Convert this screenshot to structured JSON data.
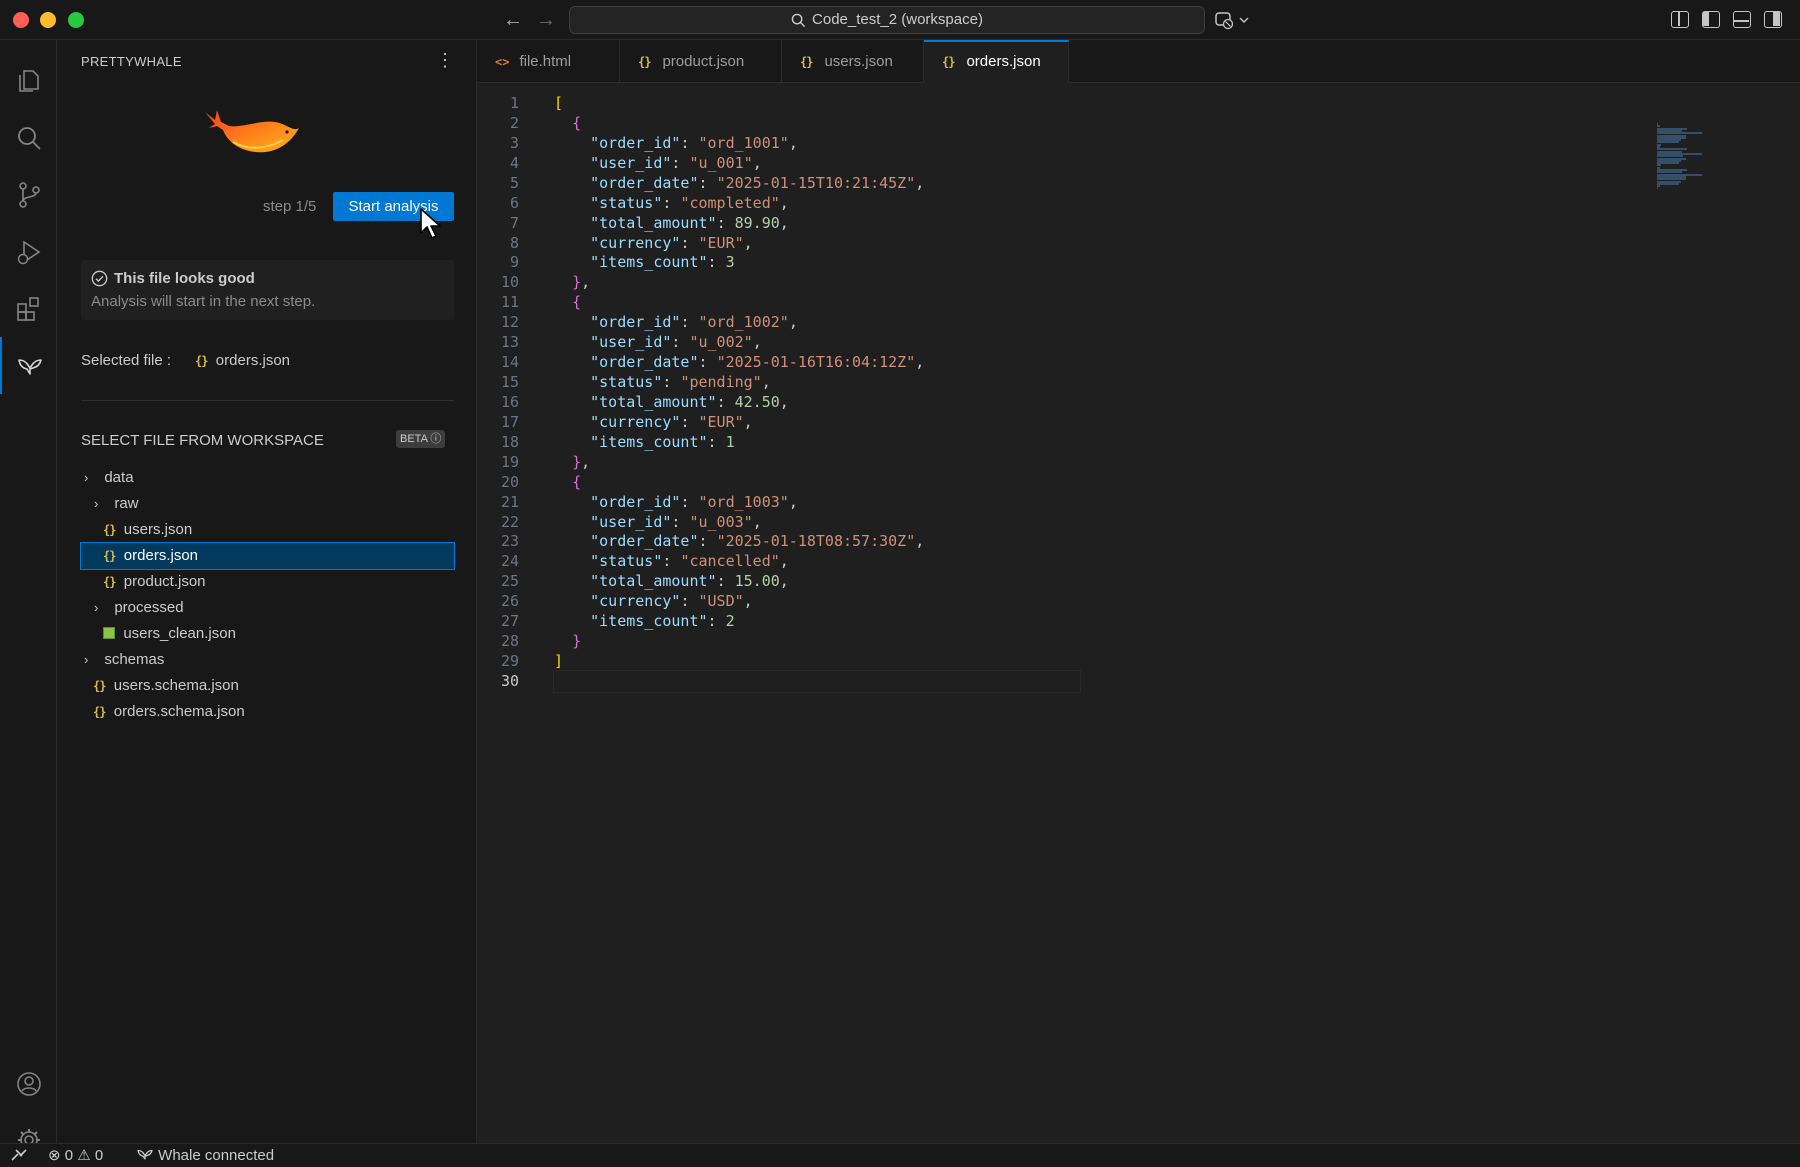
{
  "titlebar": {
    "search_text": "Code_test_2 (workspace)"
  },
  "sidebar": {
    "title": "PRETTYWHALE",
    "step_label": "step 1/5",
    "start_button": "Start analysis",
    "notice_title": "This file looks good",
    "notice_subtitle": "Analysis will start in the next step.",
    "selected_label": "Selected file :",
    "selected_file": "orders.json",
    "workspace_title": "SELECT FILE FROM WORKSPACE",
    "beta_badge": "BETA",
    "tree": [
      {
        "name": "data",
        "kind": "folder"
      },
      {
        "name": "raw",
        "kind": "folder"
      },
      {
        "name": "users.json",
        "kind": "json"
      },
      {
        "name": "orders.json",
        "kind": "json",
        "selected": true
      },
      {
        "name": "product.json",
        "kind": "json"
      },
      {
        "name": "processed",
        "kind": "folder"
      },
      {
        "name": "users_clean.json",
        "kind": "table"
      },
      {
        "name": "schemas",
        "kind": "folder"
      },
      {
        "name": "users.schema.json",
        "kind": "json"
      },
      {
        "name": "orders.schema.json",
        "kind": "json"
      }
    ]
  },
  "tabs": [
    {
      "label": "file.html",
      "icon": "html-icon"
    },
    {
      "label": "product.json",
      "icon": "json-icon"
    },
    {
      "label": "users.json",
      "icon": "json-icon"
    },
    {
      "label": "orders.json",
      "icon": "json-icon",
      "active": true
    }
  ],
  "editor": {
    "current_line": 30,
    "orders": [
      {
        "order_id": "\"ord_1001\"",
        "user_id": "\"u_001\"",
        "order_date": "\"2025-01-15T10:21:45Z\"",
        "status": "\"completed\"",
        "total_amount": "89.90",
        "currency": "\"EUR\"",
        "items_count": "3"
      },
      {
        "order_id": "\"ord_1002\"",
        "user_id": "\"u_002\"",
        "order_date": "\"2025-01-16T16:04:12Z\"",
        "status": "\"pending\"",
        "total_amount": "42.50",
        "currency": "\"EUR\"",
        "items_count": "1"
      },
      {
        "order_id": "\"ord_1003\"",
        "user_id": "\"u_003\"",
        "order_date": "\"2025-01-18T08:57:30Z\"",
        "status": "\"cancelled\"",
        "total_amount": "15.00",
        "currency": "\"USD\"",
        "items_count": "2"
      }
    ]
  },
  "statusbar": {
    "errors": "0",
    "warnings": "0",
    "whale_status": "Whale connected"
  },
  "colors": {
    "accent": "#0078d4",
    "json_key": "#9cdcfe",
    "json_string": "#ce9178",
    "json_number": "#b5cea8"
  }
}
